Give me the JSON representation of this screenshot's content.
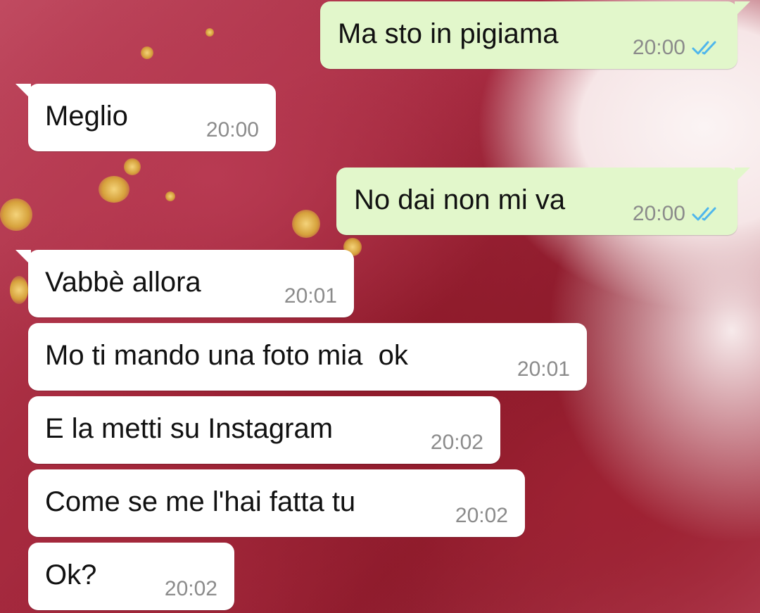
{
  "theme": {
    "incoming_bubble": "#ffffff",
    "outgoing_bubble": "#e2f7cb",
    "read_tick_color": "#4fb6ec",
    "time_color": "#8b8b8b"
  },
  "messages": [
    {
      "direction": "out",
      "text": "Ma sto in pigiama",
      "time": "20:00",
      "status_icon": "double-check-read-icon"
    },
    {
      "direction": "in",
      "text": "Meglio",
      "time": "20:00"
    },
    {
      "direction": "out",
      "text": "No dai non mi va",
      "time": "20:00",
      "status_icon": "double-check-read-icon"
    },
    {
      "direction": "in",
      "text": "Vabbè allora",
      "time": "20:01"
    },
    {
      "direction": "in",
      "text": "Mo ti mando una foto mia  ok",
      "time": "20:01"
    },
    {
      "direction": "in",
      "text": "E la metti su Instagram",
      "time": "20:02"
    },
    {
      "direction": "in",
      "text": "Come se me l'hai fatta tu",
      "time": "20:02"
    },
    {
      "direction": "in",
      "text": "Ok?",
      "time": "20:02"
    }
  ]
}
